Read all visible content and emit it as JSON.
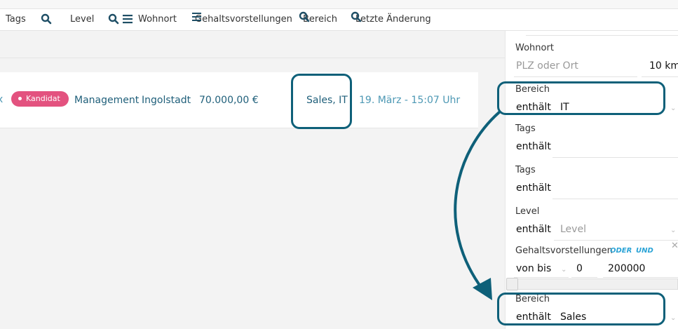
{
  "header": {
    "columns": {
      "tags": "Tags",
      "level": "Level",
      "wohnort": "Wohnort",
      "gehalt": "Gehaltsvorstellungen",
      "bereich": "Bereich",
      "letzte": "Letzte Änderung"
    }
  },
  "row": {
    "badge": "Kandidat",
    "bereich": "Management",
    "ort": "Ingolstadt",
    "gehalt": "70.000,00 €",
    "tags": "Sales, IT",
    "datum": "19. März - 15:07 Uhr"
  },
  "filters": {
    "wohnort": {
      "label": "Wohnort",
      "placeholder": "PLZ oder Ort",
      "radius": "10 km"
    },
    "bereich1": {
      "label": "Bereich",
      "operator": "enthält",
      "value": "IT"
    },
    "tags1": {
      "label": "Tags",
      "operator": "enthält"
    },
    "tags2": {
      "label": "Tags",
      "operator": "enthält"
    },
    "level": {
      "label": "Level",
      "operator": "enthält",
      "placeholder": "Level"
    },
    "gehalt": {
      "label": "Gehaltsvorstellungen",
      "oder": "ODER",
      "und": "UND",
      "operator": "von bis",
      "from": "0",
      "to": "200000"
    },
    "bereich2": {
      "label": "Bereich",
      "operator": "enthält",
      "value": "Sales"
    }
  },
  "colors": {
    "accent": "#0e6079",
    "badge": "#e3527f",
    "link": "#1f5f7a",
    "logic": "#2aa3d6"
  },
  "icons": [
    "search-icon",
    "menu-icon"
  ]
}
